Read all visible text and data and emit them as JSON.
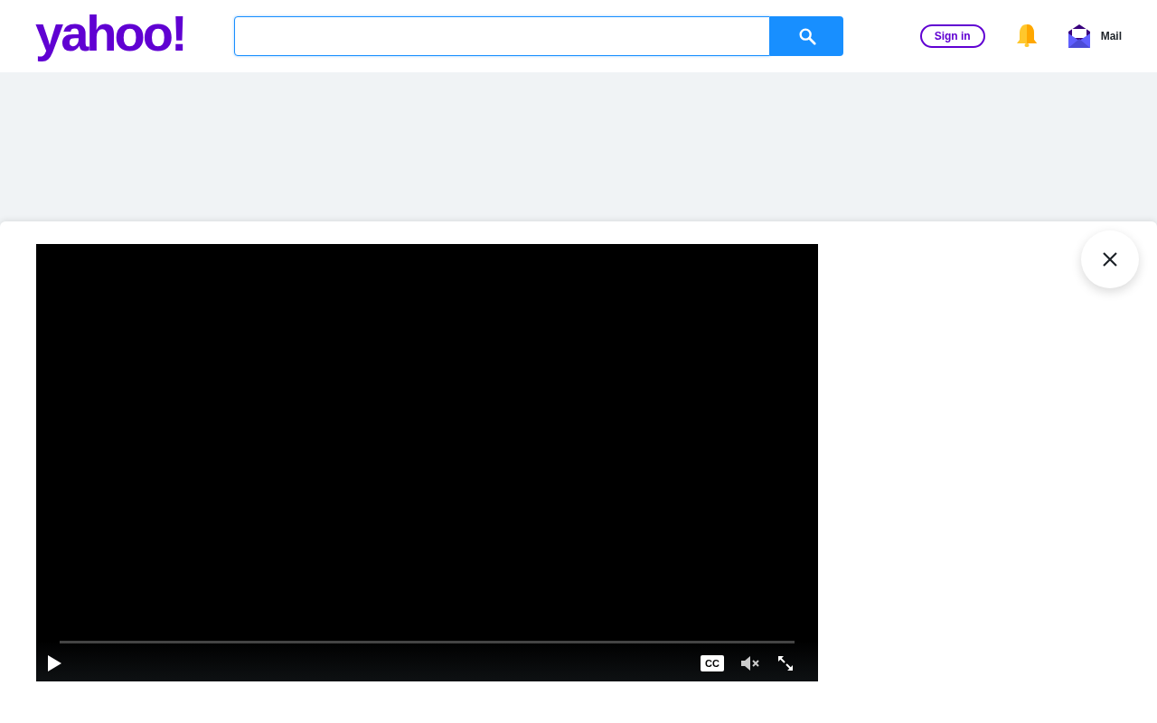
{
  "header": {
    "logo": "yahoo!",
    "sign_in": "Sign in",
    "mail": "Mail"
  },
  "video": {
    "progress": {
      "level": 0
    },
    "captions_label": "CC",
    "muted": true
  }
}
